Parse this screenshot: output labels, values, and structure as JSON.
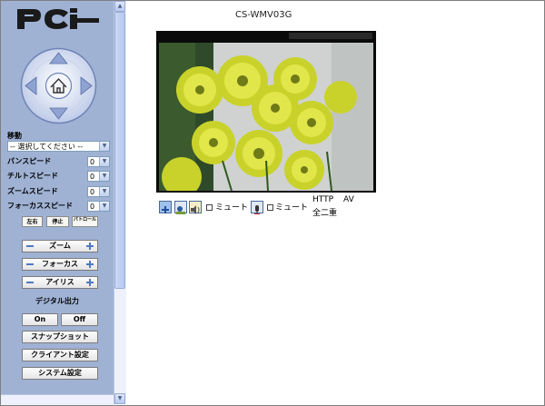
{
  "brand": {
    "logo_text": "PCi"
  },
  "sidebar": {
    "move_label": "移動",
    "move_select": "-- 選択してください --",
    "speeds": [
      {
        "label": "パンスピード",
        "value": "0"
      },
      {
        "label": "チルトスピード",
        "value": "0"
      },
      {
        "label": "ズームスピード",
        "value": "0"
      },
      {
        "label": "フォーカススピード",
        "value": "0"
      }
    ],
    "mini_buttons": [
      "左右",
      "停止",
      "パトロール"
    ],
    "adjust": [
      "ズーム",
      "フォーカス",
      "アイリス"
    ],
    "digital_out_label": "デジタル出力",
    "on_label": "On",
    "off_label": "Off",
    "buttons": [
      "スナップショット",
      "クライアント設定",
      "システム設定"
    ]
  },
  "main": {
    "camera_title": "CS-WMV03G",
    "mute_label_1": "ミュート",
    "mute_label_2": "ミュート",
    "http_label": "HTTP",
    "av_label": "AV",
    "duplex_label": "全二重"
  },
  "colors": {
    "sidebar_bg": "#9fb2d4",
    "accent": "#5178c2"
  }
}
